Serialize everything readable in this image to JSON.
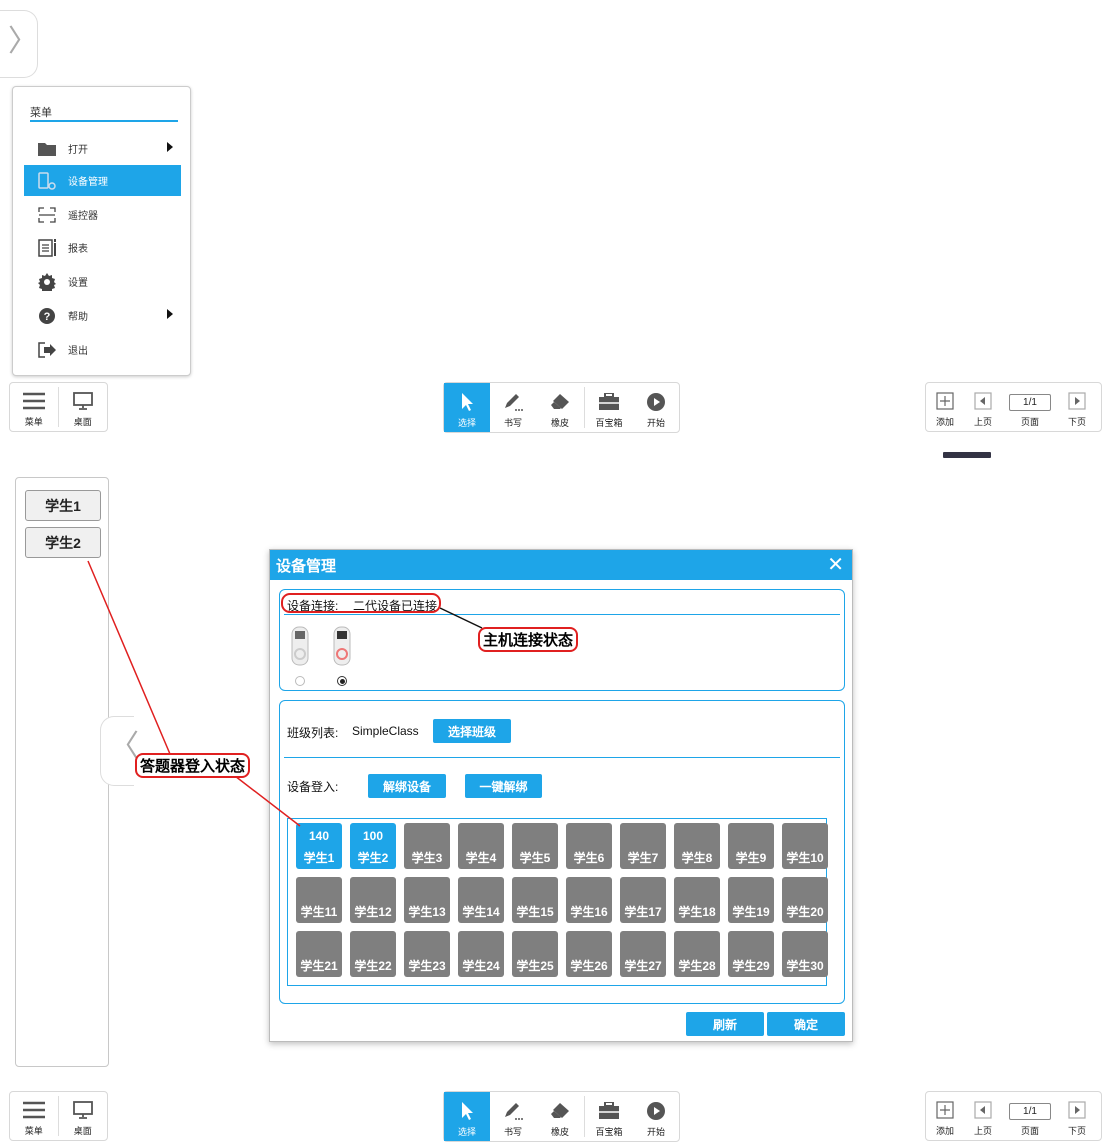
{
  "top_tab_glyph": "〉",
  "menu": {
    "title": "菜单",
    "items": [
      {
        "label": "打开",
        "icon": "folder-icon",
        "has_submenu": true
      },
      {
        "label": "设备管理",
        "icon": "device-icon",
        "active": true
      },
      {
        "label": "遥控器",
        "icon": "remote-icon"
      },
      {
        "label": "报表",
        "icon": "report-icon"
      },
      {
        "label": "设置",
        "icon": "gear-icon"
      },
      {
        "label": "帮助",
        "icon": "help-icon",
        "has_submenu": true
      },
      {
        "label": "退出",
        "icon": "exit-icon"
      }
    ]
  },
  "toolbar_left": {
    "menu": "菜单",
    "desktop": "桌面"
  },
  "toolbar_center": {
    "select": "选择",
    "write": "书写",
    "eraser": "橡皮",
    "toolbox": "百宝箱",
    "start": "开始"
  },
  "toolbar_right": {
    "add": "添加",
    "prev": "上页",
    "page_label": "页面",
    "page_value": "1/1",
    "next": "下页"
  },
  "sidebar": {
    "students": [
      "学生1",
      "学生2"
    ],
    "collapse_glyph": "〈"
  },
  "dialog": {
    "title": "设备管理",
    "close": "✕",
    "connection_label": "设备连接:",
    "connection_status": "二代设备已连接",
    "class_label": "班级列表:",
    "class_name": "SimpleClass",
    "select_class": "选择班级",
    "login_label": "设备登入:",
    "unbind": "解绑设备",
    "unbind_all": "一键解绑",
    "refresh": "刷新",
    "confirm": "确定",
    "devices": [
      {
        "score": "140",
        "name": "学生1",
        "on": true
      },
      {
        "score": "100",
        "name": "学生2",
        "on": true
      },
      {
        "name": "学生3"
      },
      {
        "name": "学生4"
      },
      {
        "name": "学生5"
      },
      {
        "name": "学生6"
      },
      {
        "name": "学生7"
      },
      {
        "name": "学生8"
      },
      {
        "name": "学生9"
      },
      {
        "name": "学生10"
      },
      {
        "name": "学生11"
      },
      {
        "name": "学生12"
      },
      {
        "name": "学生13"
      },
      {
        "name": "学生14"
      },
      {
        "name": "学生15"
      },
      {
        "name": "学生16"
      },
      {
        "name": "学生17"
      },
      {
        "name": "学生18"
      },
      {
        "name": "学生19"
      },
      {
        "name": "学生20"
      },
      {
        "name": "学生21"
      },
      {
        "name": "学生22"
      },
      {
        "name": "学生23"
      },
      {
        "name": "学生24"
      },
      {
        "name": "学生25"
      },
      {
        "name": "学生26"
      },
      {
        "name": "学生27"
      },
      {
        "name": "学生28"
      },
      {
        "name": "学生29"
      },
      {
        "name": "学生30"
      }
    ]
  },
  "annotations": {
    "host": "主机连接状态",
    "login": "答题器登入状态"
  },
  "colors": {
    "accent": "#1ea5e8",
    "inactive_cell": "#7f7f7f",
    "annotation": "#e02020"
  }
}
